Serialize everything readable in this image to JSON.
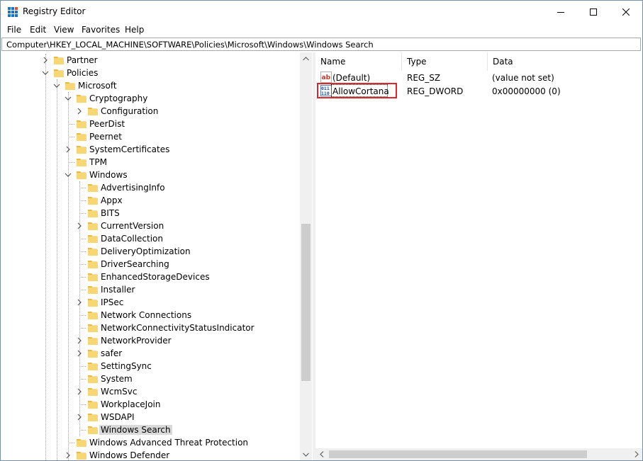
{
  "window": {
    "title": "Registry Editor",
    "controls": {
      "minimize": "minimize",
      "maximize": "maximize",
      "close": "close"
    }
  },
  "menu": [
    "File",
    "Edit",
    "View",
    "Favorites",
    "Help"
  ],
  "address": "Computer\\HKEY_LOCAL_MACHINE\\SOFTWARE\\Policies\\Microsoft\\Windows\\Windows Search",
  "tree": [
    {
      "label": "Partner",
      "depth": 0,
      "expander": "collapsed"
    },
    {
      "label": "Policies",
      "depth": 0,
      "expander": "expanded"
    },
    {
      "label": "Microsoft",
      "depth": 1,
      "expander": "expanded"
    },
    {
      "label": "Cryptography",
      "depth": 2,
      "expander": "expanded"
    },
    {
      "label": "Configuration",
      "depth": 3,
      "expander": "collapsed"
    },
    {
      "label": "PeerDist",
      "depth": 2,
      "expander": "none"
    },
    {
      "label": "Peernet",
      "depth": 2,
      "expander": "none"
    },
    {
      "label": "SystemCertificates",
      "depth": 2,
      "expander": "collapsed"
    },
    {
      "label": "TPM",
      "depth": 2,
      "expander": "none"
    },
    {
      "label": "Windows",
      "depth": 2,
      "expander": "expanded"
    },
    {
      "label": "AdvertisingInfo",
      "depth": 3,
      "expander": "none"
    },
    {
      "label": "Appx",
      "depth": 3,
      "expander": "none"
    },
    {
      "label": "BITS",
      "depth": 3,
      "expander": "none"
    },
    {
      "label": "CurrentVersion",
      "depth": 3,
      "expander": "collapsed"
    },
    {
      "label": "DataCollection",
      "depth": 3,
      "expander": "none"
    },
    {
      "label": "DeliveryOptimization",
      "depth": 3,
      "expander": "none"
    },
    {
      "label": "DriverSearching",
      "depth": 3,
      "expander": "none"
    },
    {
      "label": "EnhancedStorageDevices",
      "depth": 3,
      "expander": "none"
    },
    {
      "label": "Installer",
      "depth": 3,
      "expander": "none"
    },
    {
      "label": "IPSec",
      "depth": 3,
      "expander": "collapsed"
    },
    {
      "label": "Network Connections",
      "depth": 3,
      "expander": "none"
    },
    {
      "label": "NetworkConnectivityStatusIndicator",
      "depth": 3,
      "expander": "none"
    },
    {
      "label": "NetworkProvider",
      "depth": 3,
      "expander": "collapsed"
    },
    {
      "label": "safer",
      "depth": 3,
      "expander": "collapsed"
    },
    {
      "label": "SettingSync",
      "depth": 3,
      "expander": "none"
    },
    {
      "label": "System",
      "depth": 3,
      "expander": "none"
    },
    {
      "label": "WcmSvc",
      "depth": 3,
      "expander": "collapsed"
    },
    {
      "label": "WorkplaceJoin",
      "depth": 3,
      "expander": "none"
    },
    {
      "label": "WSDAPI",
      "depth": 3,
      "expander": "collapsed"
    },
    {
      "label": "Windows Search",
      "depth": 3,
      "expander": "none",
      "selected": true
    },
    {
      "label": "Windows Advanced Threat Protection",
      "depth": 2,
      "expander": "none"
    },
    {
      "label": "Windows Defender",
      "depth": 2,
      "expander": "collapsed"
    }
  ],
  "list": {
    "columns": [
      "Name",
      "Type",
      "Data"
    ],
    "rows": [
      {
        "name": "(Default)",
        "type": "REG_SZ",
        "data": "(value not set)",
        "icon": "string-value-icon"
      },
      {
        "name": "AllowCortana",
        "type": "REG_DWORD",
        "data": "0x00000000 (0)",
        "icon": "dword-value-icon",
        "highlighted": true
      }
    ]
  },
  "colors": {
    "selection": "#d9d9d9",
    "highlight": "#e0262b",
    "folder": "#f7d774"
  }
}
